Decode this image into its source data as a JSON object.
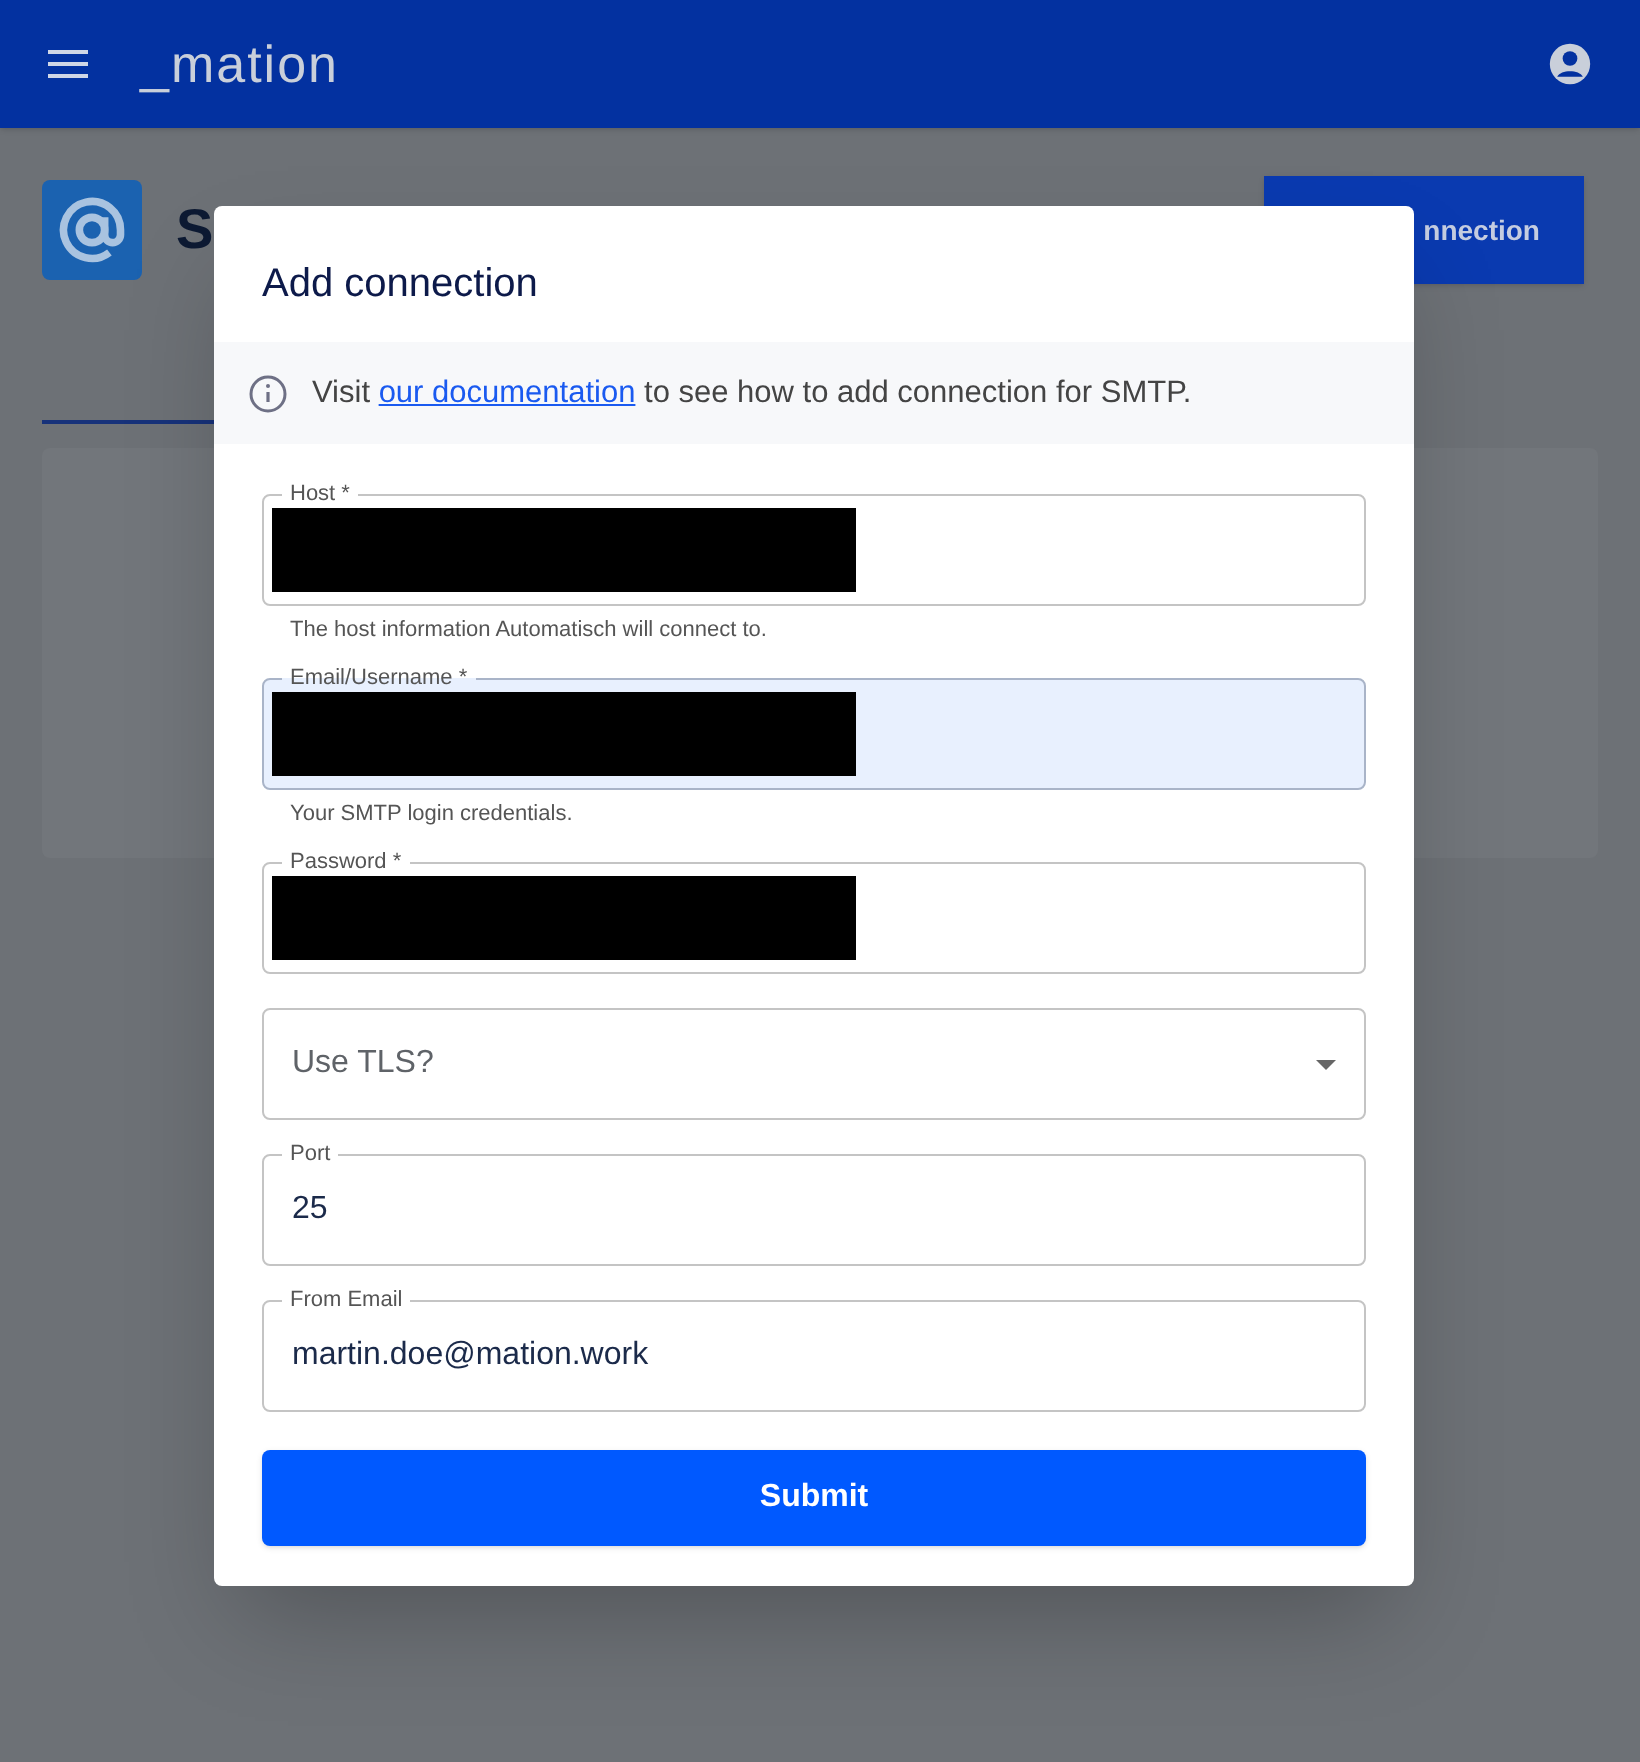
{
  "app_bar": {
    "logo": "_mation"
  },
  "page": {
    "title": "S",
    "action_button": "nnection",
    "tabs_underline": true
  },
  "dialog": {
    "title": "Add connection",
    "notice": {
      "before": "Visit ",
      "link": "our documentation",
      "after": " to see how to add connection for SMTP."
    },
    "fields": [
      {
        "kind": "text",
        "label": "Host *",
        "redacted": true,
        "autofilled": false,
        "helper": "The host information Automatisch will connect to."
      },
      {
        "kind": "text",
        "label": "Email/Username *",
        "redacted": true,
        "autofilled": true,
        "helper": "Your SMTP login credentials."
      },
      {
        "kind": "text",
        "label": "Password *",
        "redacted": true,
        "autofilled": false
      },
      {
        "kind": "select",
        "placeholder": "Use TLS?"
      },
      {
        "kind": "text",
        "label": "Port",
        "value": "25",
        "autofilled": false
      },
      {
        "kind": "text",
        "label": "From Email",
        "value": "martin.doe@mation.work",
        "autofilled": false
      }
    ],
    "submit": "Submit"
  }
}
